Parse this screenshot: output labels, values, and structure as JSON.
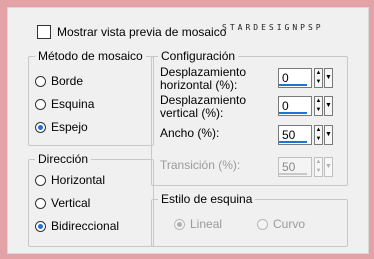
{
  "preview_checkbox": {
    "label": "Mostrar vista previa de mosaico",
    "checked": false
  },
  "watermark": "STARDESIGNPSP",
  "tile_method": {
    "title": "Método de mosaico",
    "options": [
      {
        "label": "Borde",
        "checked": false
      },
      {
        "label": "Esquina",
        "checked": false
      },
      {
        "label": "Espejo",
        "checked": true
      }
    ]
  },
  "direction": {
    "title": "Dirección",
    "options": [
      {
        "label": "Horizontal",
        "checked": false
      },
      {
        "label": "Vertical",
        "checked": false
      },
      {
        "label": "Bidireccional",
        "checked": true
      }
    ]
  },
  "configuration": {
    "title": "Configuración",
    "params": [
      {
        "label_line1": "Desplazamiento",
        "label_line2": "horizontal (%):",
        "value": "0",
        "enabled": true
      },
      {
        "label_line1": "Desplazamiento",
        "label_line2": "vertical (%):",
        "value": "0",
        "enabled": true
      },
      {
        "label_line1": "Ancho (%):",
        "label_line2": "",
        "value": "50",
        "enabled": true
      },
      {
        "label_line1": "Transición (%):",
        "label_line2": "",
        "value": "50",
        "enabled": false
      }
    ]
  },
  "corner_style": {
    "title": "Estilo de esquina",
    "options": [
      {
        "label": "Lineal",
        "checked": true,
        "enabled": false
      },
      {
        "label": "Curvo",
        "checked": false,
        "enabled": false
      }
    ]
  },
  "colors": {
    "accent": "#1e74d4",
    "frame": "#e3a3a6",
    "panel": "#f0f0f0"
  }
}
